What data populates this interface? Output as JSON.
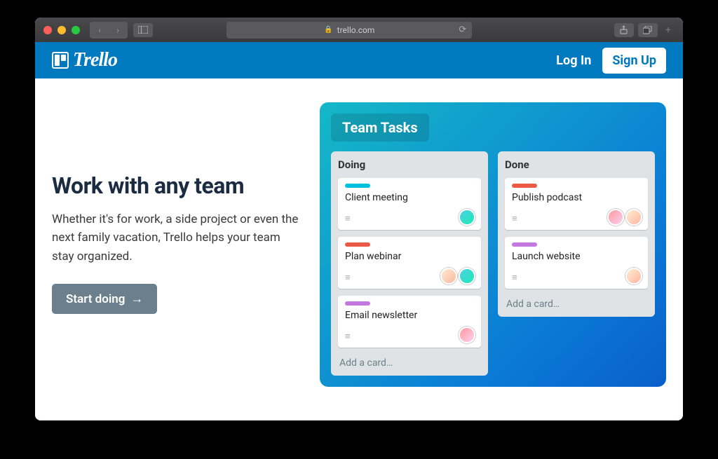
{
  "browser": {
    "url": "trello.com"
  },
  "header": {
    "brand": "Trello",
    "login": "Log In",
    "signup": "Sign Up"
  },
  "hero": {
    "title": "Work with any team",
    "subtitle": "Whether it's for work, a side project or even the next family vacation, Trello helps your team stay organized.",
    "cta": "Start doing",
    "cta_arrow": "→"
  },
  "board": {
    "title": "Team Tasks",
    "lists": [
      {
        "title": "Doing",
        "add": "Add a card…",
        "cards": [
          {
            "label_color": "teal",
            "title": "Client meeting",
            "avatars": [
              "teal"
            ]
          },
          {
            "label_color": "red",
            "title": "Plan webinar",
            "avatars": [
              "peach",
              "teal"
            ]
          },
          {
            "label_color": "purple",
            "title": "Email newsletter",
            "avatars": [
              "pink"
            ]
          }
        ]
      },
      {
        "title": "Done",
        "add": "Add a card…",
        "cards": [
          {
            "label_color": "red",
            "title": "Publish podcast",
            "avatars": [
              "pink",
              "peach"
            ]
          },
          {
            "label_color": "purple",
            "title": "Launch website",
            "avatars": [
              "peach"
            ]
          }
        ]
      }
    ]
  }
}
